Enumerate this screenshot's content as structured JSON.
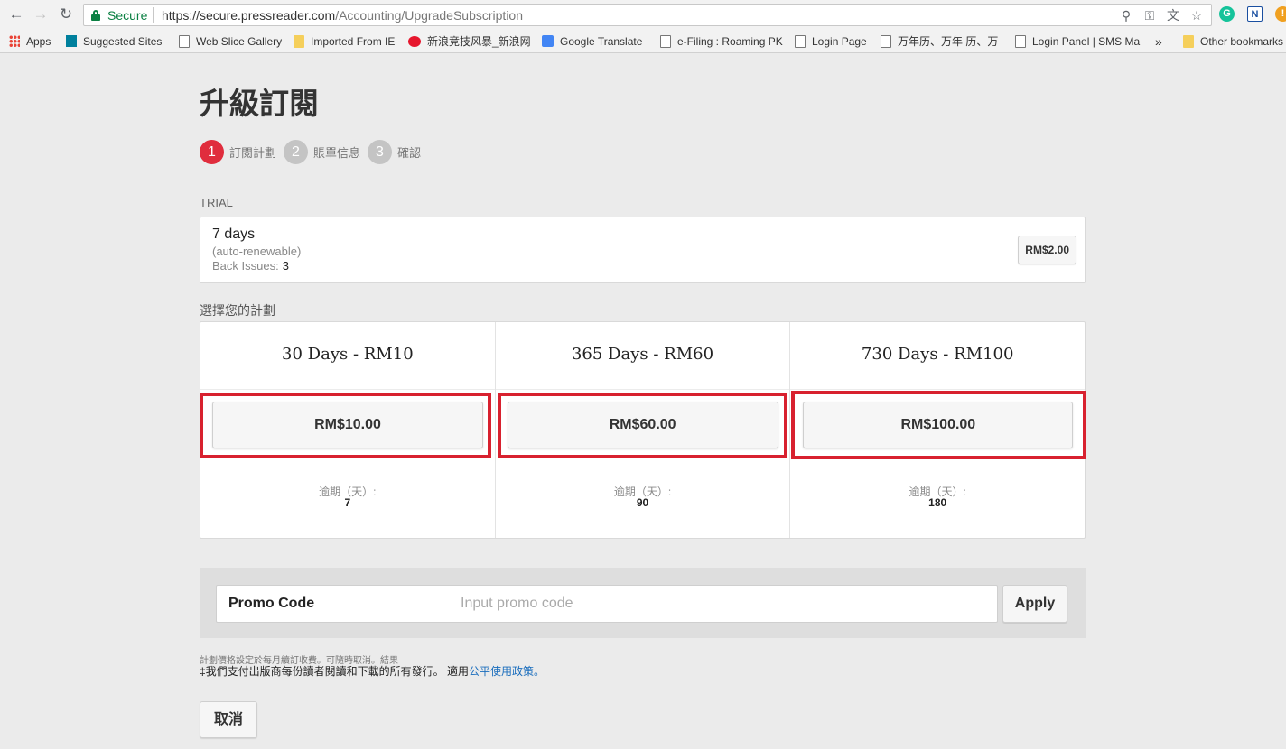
{
  "browser": {
    "secure_label": "Secure",
    "url_host": "https://secure.pressreader.com",
    "url_path": "/Accounting/UpgradeSubscription",
    "bookmarks": [
      {
        "label": "Apps",
        "icon": "apps-grid-icon"
      },
      {
        "label": "Suggested Sites",
        "icon": "bing-icon"
      },
      {
        "label": "Web Slice Gallery",
        "icon": "page-icon"
      },
      {
        "label": "Imported From IE",
        "icon": "folder-icon"
      },
      {
        "label": "新浪竞技风暴_新浪网",
        "icon": "weibo-icon"
      },
      {
        "label": "Google Translate",
        "icon": "translate-icon"
      },
      {
        "label": "e-Filing : Roaming PK",
        "icon": "page-icon"
      },
      {
        "label": "Login Page",
        "icon": "page-icon"
      },
      {
        "label": "万年历、万年 历、万",
        "icon": "page-icon"
      },
      {
        "label": "Login Panel | SMS Ma",
        "icon": "page-icon"
      },
      {
        "label": "»",
        "icon": "overflow-chevron-icon"
      },
      {
        "label": "Other bookmarks",
        "icon": "folder-icon"
      }
    ]
  },
  "page": {
    "title": "升級訂閱",
    "steps": [
      {
        "num": "1",
        "label": "訂閱計劃",
        "active": true
      },
      {
        "num": "2",
        "label": "賬單信息",
        "active": false
      },
      {
        "num": "3",
        "label": "確認",
        "active": false
      }
    ],
    "trial": {
      "section_label": "TRIAL",
      "days": "7 days",
      "auto": "(auto-renewable)",
      "back_issues_label": "Back Issues:",
      "back_issues_value": "3",
      "price": "RM$2.00"
    },
    "choose_label": "選擇您的計劃",
    "plans": [
      {
        "title": "30 Days - RM10",
        "price": "RM$10.00",
        "expire_label": "逾期（天）:",
        "expire_value": "7"
      },
      {
        "title": "365 Days - RM60",
        "price": "RM$60.00",
        "expire_label": "逾期（天）:",
        "expire_value": "90"
      },
      {
        "title": "730 Days - RM100",
        "price": "RM$100.00",
        "expire_label": "逾期（天）:",
        "expire_value": "180"
      }
    ],
    "promo": {
      "label": "Promo Code",
      "placeholder": "Input promo code",
      "value": "",
      "apply": "Apply"
    },
    "fine_print_1": "計劃價格設定於每月續訂收費。可隨時取消。結果",
    "fine_print_2": "‡我們支付出版商每份讀者閱讀和下載的所有發行。 適用",
    "fine_print_link": "公平使用政策。",
    "cancel": "取消"
  },
  "colors": {
    "accent_red": "#e02d3d",
    "highlight_red": "#d8212f",
    "secure_green": "#0b8043",
    "link_blue": "#1a6dbd"
  }
}
